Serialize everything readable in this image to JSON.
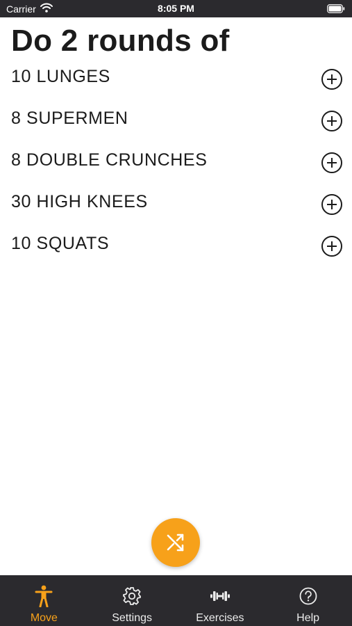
{
  "status_bar": {
    "carrier": "Carrier",
    "time": "8:05 PM"
  },
  "workout": {
    "title": "Do 2 rounds of",
    "exercises": [
      {
        "label": "10 LUNGES"
      },
      {
        "label": "8 SUPERMEN"
      },
      {
        "label": "8 DOUBLE CRUNCHES"
      },
      {
        "label": "30 HIGH KNEES"
      },
      {
        "label": "10 SQUATS"
      }
    ]
  },
  "tab_bar": {
    "tabs": [
      {
        "label": "Move",
        "icon": "person-icon",
        "active": true
      },
      {
        "label": "Settings",
        "icon": "gear-icon",
        "active": false
      },
      {
        "label": "Exercises",
        "icon": "dumbbell-icon",
        "active": false
      },
      {
        "label": "Help",
        "icon": "question-circle-icon",
        "active": false
      }
    ]
  },
  "colors": {
    "accent": "#f7a11a",
    "bar_background": "#2b2a2e",
    "text": "#1b1b1b"
  }
}
